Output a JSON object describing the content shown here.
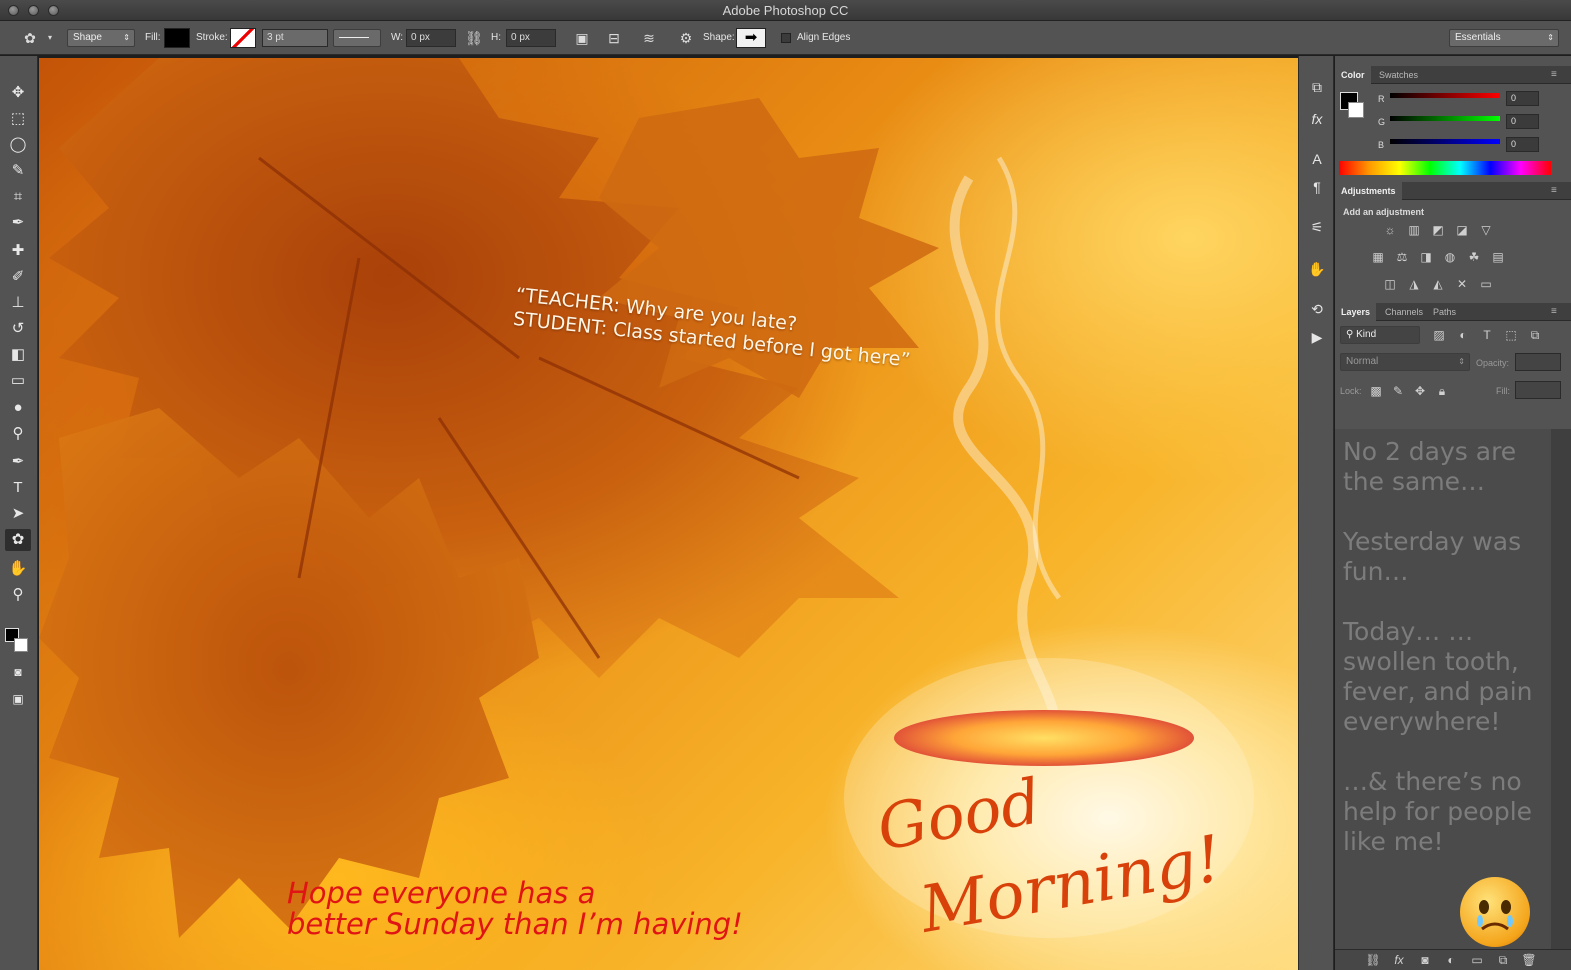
{
  "app": {
    "title": "Adobe Photoshop CC"
  },
  "options_bar": {
    "tool_mode": "Shape",
    "fill_label": "Fill:",
    "stroke_label": "Stroke:",
    "stroke_width": "3 pt",
    "w_label": "W:",
    "w_value": "0 px",
    "h_label": "H:",
    "h_value": "0 px",
    "shape_label": "Shape:",
    "align_edges_label": "Align Edges",
    "workspace": "Essentials"
  },
  "canvas": {
    "quote_line1": "“TEACHER: Why are you late?",
    "quote_line2": "STUDENT: Class started before I got here”",
    "hope_line1": "Hope everyone has a",
    "hope_line2": "better Sunday than I’m having!",
    "good": "Good",
    "morning": "Morning!"
  },
  "color_panel": {
    "tabs": [
      "Color",
      "Swatches"
    ],
    "r_label": "R",
    "r_value": "0",
    "g_label": "G",
    "g_value": "0",
    "b_label": "B",
    "b_value": "0"
  },
  "adjustments_panel": {
    "tab": "Adjustments",
    "heading": "Add an adjustment"
  },
  "layers_panel": {
    "tabs": [
      "Layers",
      "Channels",
      "Paths"
    ],
    "filter_kind": "Kind",
    "blend_mode": "Normal",
    "opacity_label": "Opacity:",
    "lock_label": "Lock:",
    "fill_label": "Fill:"
  },
  "side_note": {
    "p1": "No 2 days are the same…",
    "p2": "Yesterday was fun…",
    "p3": "Today… …swollen tooth, fever, and pain everywhere!",
    "p4": "…& there’s no help for people like me!"
  }
}
